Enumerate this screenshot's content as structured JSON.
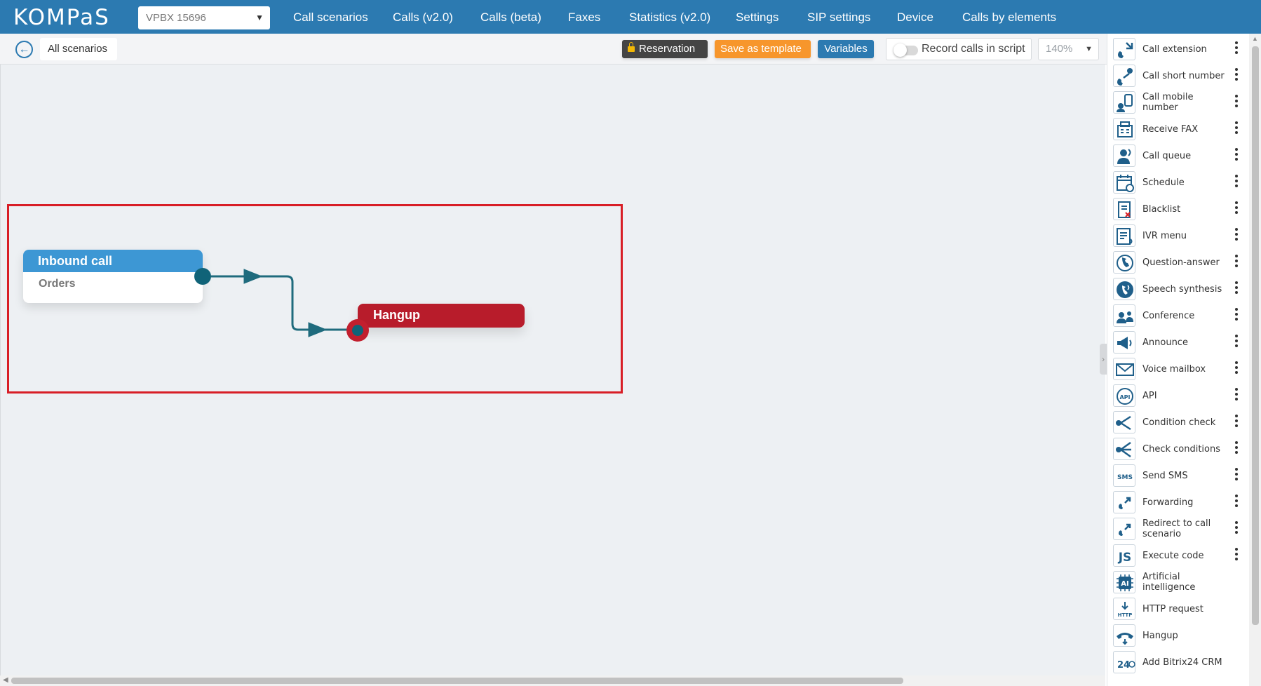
{
  "logo": "KOMPaS",
  "pbx_select": {
    "value": "VPBX 15696"
  },
  "nav": [
    "Call scenarios",
    "Calls (v2.0)",
    "Calls (beta)",
    "Faxes",
    "Statistics (v2.0)",
    "Settings",
    "SIP settings",
    "Device",
    "Calls by elements"
  ],
  "toolbar": {
    "all_scenarios": "All scenarios",
    "reservation": "Reservation",
    "save_template": "Save as template",
    "variables": "Variables",
    "record_calls": "Record calls in script",
    "zoom": "140%"
  },
  "canvas": {
    "inbound": {
      "title": "Inbound call",
      "subtitle": "Orders"
    },
    "hangup": {
      "title": "Hangup"
    }
  },
  "panel_items": [
    {
      "label": "Call extension",
      "icon": "call-extension-icon"
    },
    {
      "label": "Call short number",
      "icon": "call-short-number-icon"
    },
    {
      "label": "Call mobile number",
      "icon": "mobile-icon"
    },
    {
      "label": "Receive FAX",
      "icon": "fax-icon"
    },
    {
      "label": "Call queue",
      "icon": "queue-icon"
    },
    {
      "label": "Schedule",
      "icon": "calendar-icon"
    },
    {
      "label": "Blacklist",
      "icon": "blacklist-icon"
    },
    {
      "label": "IVR menu",
      "icon": "ivr-icon"
    },
    {
      "label": "Question-answer",
      "icon": "question-answer-icon"
    },
    {
      "label": "Speech synthesis",
      "icon": "speech-icon"
    },
    {
      "label": "Conference",
      "icon": "conference-icon"
    },
    {
      "label": "Announce",
      "icon": "megaphone-icon"
    },
    {
      "label": "Voice mailbox",
      "icon": "mail-icon"
    },
    {
      "label": "API",
      "icon": "api-icon"
    },
    {
      "label": "Condition check",
      "icon": "branch-icon"
    },
    {
      "label": "Check conditions",
      "icon": "branches-icon"
    },
    {
      "label": "Send SMS",
      "icon": "sms-icon"
    },
    {
      "label": "Forwarding",
      "icon": "forward-icon"
    },
    {
      "label": "Redirect to call scenario",
      "icon": "redirect-icon"
    },
    {
      "label": "Execute code",
      "icon": "js-icon"
    },
    {
      "label": "Artificial intelligence",
      "icon": "ai-icon"
    },
    {
      "label": "HTTP request",
      "icon": "http-icon"
    },
    {
      "label": "Hangup",
      "icon": "hangup-icon"
    },
    {
      "label": "Add Bitrix24 CRM",
      "icon": "bitrix24-icon"
    }
  ],
  "icon_glyphs": {
    "sms": "SMS",
    "js": "JS",
    "ai": "AI",
    "http": "HTTP",
    "api": "API",
    "b24": "24"
  },
  "colors": {
    "brand": "#2c7ab1",
    "inbound": "#3d97d4",
    "hangup": "#b81c2b",
    "connector": "#1f6b7d",
    "template_button": "#f7962c",
    "highlight": "#d81e26"
  }
}
